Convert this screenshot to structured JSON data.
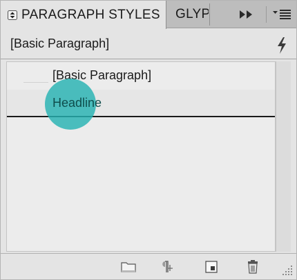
{
  "tabs": [
    {
      "label": "PARAGRAPH STYLES",
      "active": true
    },
    {
      "label": "GLYP",
      "active": false
    }
  ],
  "panel": {
    "current_style": "[Basic Paragraph]"
  },
  "styles_list": [
    {
      "label": "[Basic Paragraph]"
    },
    {
      "label": "Headline"
    }
  ],
  "icons": {
    "collapse": "collapse-arrows-icon",
    "expand": "double-chevron-right-icon",
    "menu": "panel-menu-icon",
    "lightning": "lightning-icon",
    "new_group": "folder-icon",
    "clear_overrides": "pilcrow-clear-icon",
    "new_style": "new-page-icon",
    "delete": "trash-icon",
    "resize": "resize-grip-icon"
  },
  "colors": {
    "highlight": "#26b2b2",
    "headline_text": "#0e4d4c"
  }
}
